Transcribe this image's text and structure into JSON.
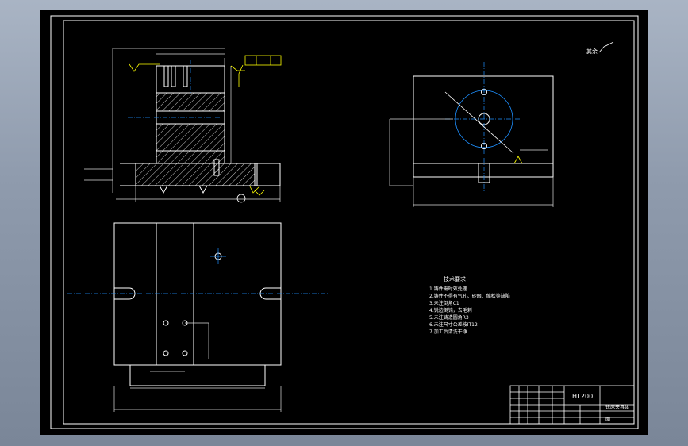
{
  "drawing": {
    "material_code": "HT200",
    "corner_note": "其余",
    "tech_requirements": {
      "heading": "技术要求",
      "items": [
        "1.铸件需时效处理",
        "2.铸件不得有气孔、砂眼、缩松等缺陷",
        "3.未注倒角C1",
        "4.锐边倒钝，去毛刺",
        "5.未注铸造圆角R3",
        "6.未注尺寸公差按IT12",
        "7.加工后清洗干净"
      ]
    },
    "title_block": {
      "part_name": "铣床夹具体",
      "drawing_label": "图"
    },
    "colors": {
      "frame": "#ffffff",
      "dimension": "#e6e6e6",
      "centerline": "#1e90ff",
      "annotation": "#ffff00",
      "hatch": "#ffffff"
    }
  }
}
